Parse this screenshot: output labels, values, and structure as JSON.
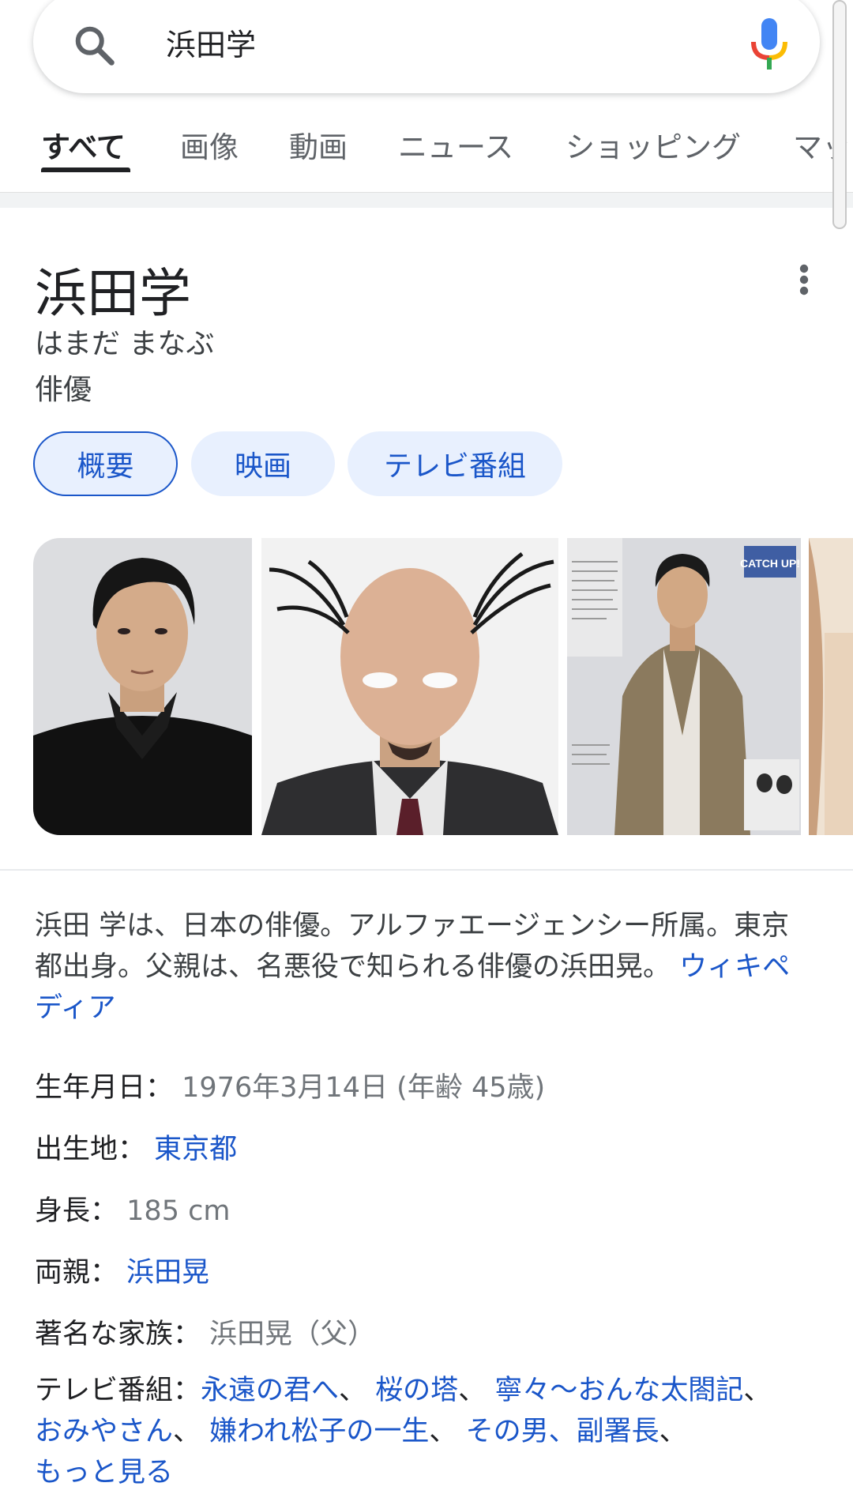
{
  "search": {
    "query": "浜田学"
  },
  "tabs": [
    {
      "label": "すべて"
    },
    {
      "label": "画像"
    },
    {
      "label": "動画"
    },
    {
      "label": "ニュース"
    },
    {
      "label": "ショッピング"
    },
    {
      "label": "マッ"
    }
  ],
  "entity": {
    "title": "浜田学",
    "reading": "はまだ まなぶ",
    "subtitle": "俳優"
  },
  "chips": [
    {
      "label": "概要"
    },
    {
      "label": "映画"
    },
    {
      "label": "テレビ番組"
    }
  ],
  "description": {
    "text": "浜田 学は、日本の俳優。アルファエージェンシー所属。東京都出身。父親は、名悪役で知られる俳優の浜田晃。",
    "source": "ウィキペディア"
  },
  "facts": {
    "birth": {
      "label": "生年月日：",
      "value": "1976年3月14日 (年齢 45歳)"
    },
    "birthplace": {
      "label": "出生地：",
      "value": "東京都"
    },
    "height": {
      "label": "身長：",
      "value": "185 cm"
    },
    "parents": {
      "label": "両親：",
      "value": "浜田晃"
    },
    "family": {
      "label": "著名な家族：",
      "value": "浜田晃（父）"
    },
    "tv": {
      "label": "テレビ番組：",
      "items": [
        "永遠の君へ",
        "桜の塔",
        "寧々〜おんな太閤記",
        "おみやさん",
        "嫌われ松子の一生",
        "その男、副署長"
      ],
      "more": "もっと見る"
    }
  },
  "photo_overlay": {
    "magazine_title": "CATCH UP!"
  },
  "colors": {
    "link": "#1a56c9",
    "chip_bg": "#e8f0fe",
    "mic_blue": "#4285f4",
    "mic_red": "#ea4335",
    "mic_yellow": "#fbbc04",
    "mic_green": "#34a853"
  },
  "icons": {
    "search": "search-icon",
    "mic": "mic-icon",
    "more": "more-vert-icon"
  }
}
